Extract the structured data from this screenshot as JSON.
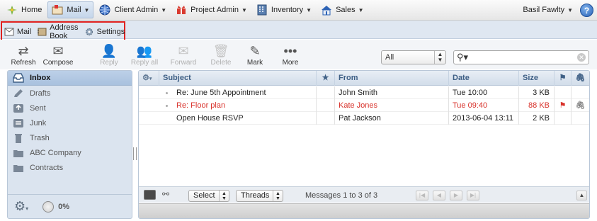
{
  "topnav": {
    "items": [
      {
        "label": "Home",
        "icon": "home-icon",
        "dropdown": false
      },
      {
        "label": "Mail",
        "icon": "mail-icon",
        "dropdown": true,
        "active": true
      },
      {
        "label": "Client Admin",
        "icon": "globe-icon",
        "dropdown": true
      },
      {
        "label": "Project Admin",
        "icon": "gift-icon",
        "dropdown": true
      },
      {
        "label": "Inventory",
        "icon": "building-icon",
        "dropdown": true
      },
      {
        "label": "Sales",
        "icon": "house-icon",
        "dropdown": true
      }
    ],
    "user": "Basil Fawlty",
    "help_label": "?"
  },
  "subtabs": [
    {
      "label": "Mail",
      "icon": "mail-small-icon"
    },
    {
      "label": "Address Book",
      "icon": "address-book-icon"
    },
    {
      "label": "Settings",
      "icon": "gear-icon"
    }
  ],
  "toolbar": {
    "buttons": [
      {
        "label": "Refresh",
        "icon": "refresh-icon",
        "enabled": true
      },
      {
        "label": "Compose",
        "icon": "compose-icon",
        "enabled": true
      },
      {
        "label": "Reply",
        "icon": "reply-icon",
        "enabled": false
      },
      {
        "label": "Reply all",
        "icon": "reply-all-icon",
        "enabled": false
      },
      {
        "label": "Forward",
        "icon": "forward-icon",
        "enabled": false
      },
      {
        "label": "Delete",
        "icon": "trash-icon",
        "enabled": false
      },
      {
        "label": "Mark",
        "icon": "pen-icon",
        "enabled": true
      },
      {
        "label": "More",
        "icon": "more-icon",
        "enabled": true
      }
    ],
    "filter_value": "All",
    "search_placeholder": ""
  },
  "folders": [
    {
      "label": "Inbox",
      "icon": "inbox-icon",
      "selected": true
    },
    {
      "label": "Drafts",
      "icon": "drafts-icon"
    },
    {
      "label": "Sent",
      "icon": "sent-icon"
    },
    {
      "label": "Junk",
      "icon": "junk-icon"
    },
    {
      "label": "Trash",
      "icon": "trash-icon"
    },
    {
      "label": "ABC Company",
      "icon": "folder-icon"
    },
    {
      "label": "Contracts",
      "icon": "folder-icon"
    }
  ],
  "quota": "0%",
  "columns": {
    "subject": "Subject",
    "from": "From",
    "date": "Date",
    "size": "Size"
  },
  "messages": [
    {
      "subject": "Re: June 5th Appointment",
      "from": "John Smith",
      "date": "Tue 10:00",
      "size": "3 KB",
      "flagged": false,
      "attachment": false,
      "threaded": true
    },
    {
      "subject": "Re: Floor plan",
      "from": "Kate Jones",
      "date": "Tue 09:40",
      "size": "88 KB",
      "flagged": true,
      "attachment": true,
      "threaded": true
    },
    {
      "subject": "Open House RSVP",
      "from": "Pat Jackson",
      "date": "2013-06-04 13:11",
      "size": "2 KB",
      "flagged": false,
      "attachment": false,
      "threaded": false
    }
  ],
  "list_footer": {
    "select_label": "Select",
    "threads_label": "Threads",
    "pager_text": "Messages 1 to 3 of 3"
  },
  "colors": {
    "accent": "#3e5f85",
    "flagged": "#d8312a",
    "highlight_box": "#e0211f"
  }
}
